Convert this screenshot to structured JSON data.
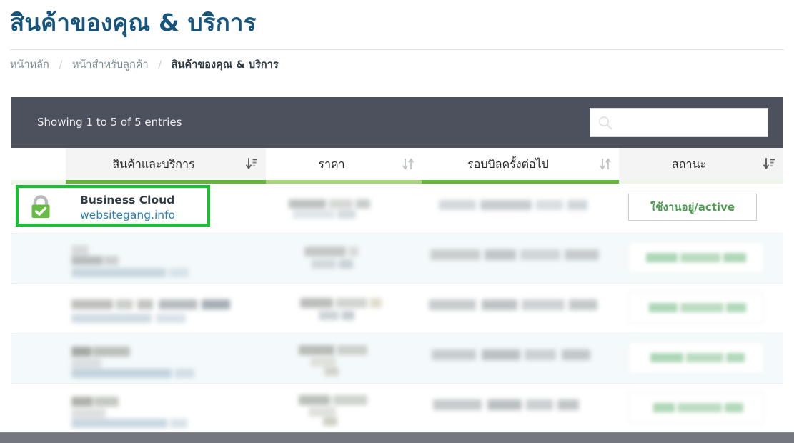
{
  "header": {
    "title": "สินค้าของคุณ & บริการ",
    "title_color": "#17547c"
  },
  "breadcrumb": {
    "items": [
      {
        "label": "หน้าหลัก",
        "active": false
      },
      {
        "label": "หน้าสำหรับลูกค้า",
        "active": false
      },
      {
        "label": "สินค้าของคุณ & บริการ",
        "active": true
      }
    ],
    "separator": "/"
  },
  "toolbar": {
    "entries_info": "Showing 1 to 5 of 5 entries",
    "background_color": "#4c515d",
    "search": {
      "value": "",
      "placeholder": "",
      "icon": "search-icon"
    }
  },
  "table": {
    "accent_color": "#63b63a",
    "columns": [
      {
        "key": "spacer",
        "label": "",
        "sort": "none",
        "shaded": false
      },
      {
        "key": "product",
        "label": "สินค้าและบริการ",
        "sort": "desc",
        "shaded": true
      },
      {
        "key": "price",
        "label": "ราคา",
        "sort": "none",
        "shaded": false
      },
      {
        "key": "next_due",
        "label": "รอบบิลครั้งต่อไป",
        "sort": "none",
        "shaded": false
      },
      {
        "key": "status",
        "label": "สถานะ",
        "sort": "desc",
        "shaded": true
      }
    ],
    "rows": [
      {
        "highlighted": true,
        "redacted": false,
        "icon": "green-padlock-check-icon",
        "product_name": "Business Cloud",
        "product_domain": "websitegang.info",
        "price": "",
        "next_due": "",
        "status": "ใช้งานอยู่/active"
      },
      {
        "highlighted": false,
        "redacted": true,
        "product_name": "",
        "product_domain": "",
        "price": "",
        "next_due": "",
        "status": ""
      },
      {
        "highlighted": false,
        "redacted": true,
        "product_name": "",
        "product_domain": "",
        "price": "",
        "next_due": "",
        "status": ""
      },
      {
        "highlighted": false,
        "redacted": true,
        "product_name": "",
        "product_domain": "",
        "price": "",
        "next_due": "",
        "status": ""
      },
      {
        "highlighted": false,
        "redacted": true,
        "product_name": "",
        "product_domain": "",
        "price": "",
        "next_due": "",
        "status": ""
      }
    ]
  },
  "scrollbar": {
    "orientation": "horizontal",
    "color": "#6f7278"
  }
}
